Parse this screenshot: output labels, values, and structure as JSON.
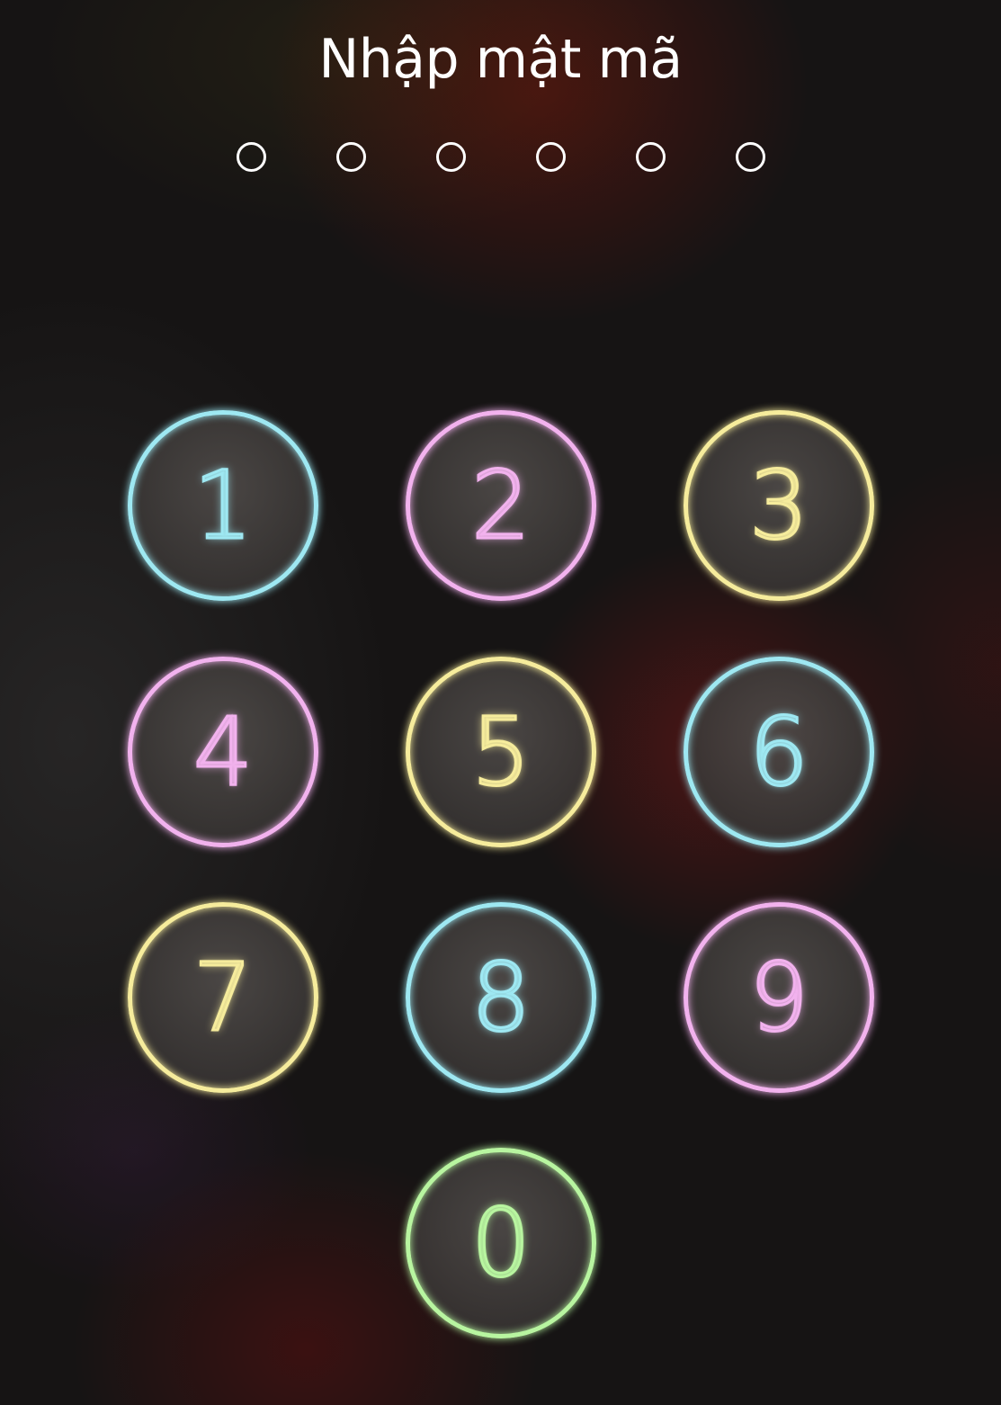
{
  "title": "Nhập mật mã",
  "passcode": {
    "length": 6,
    "entered": 0
  },
  "colors": {
    "cyan": "#9ee8f2",
    "pink": "#f2b2ee",
    "yellow": "#f6ec9c",
    "green": "#b8f5a0"
  },
  "keypad": [
    {
      "digit": "1",
      "color": "#9ee8f2"
    },
    {
      "digit": "2",
      "color": "#f2b2ee"
    },
    {
      "digit": "3",
      "color": "#f6ec9c"
    },
    {
      "digit": "4",
      "color": "#f2b2ee"
    },
    {
      "digit": "5",
      "color": "#f6ec9c"
    },
    {
      "digit": "6",
      "color": "#9ee8f2"
    },
    {
      "digit": "7",
      "color": "#f6ec9c"
    },
    {
      "digit": "8",
      "color": "#9ee8f2"
    },
    {
      "digit": "9",
      "color": "#f2b2ee"
    },
    {
      "digit": "0",
      "color": "#b8f5a0"
    }
  ]
}
